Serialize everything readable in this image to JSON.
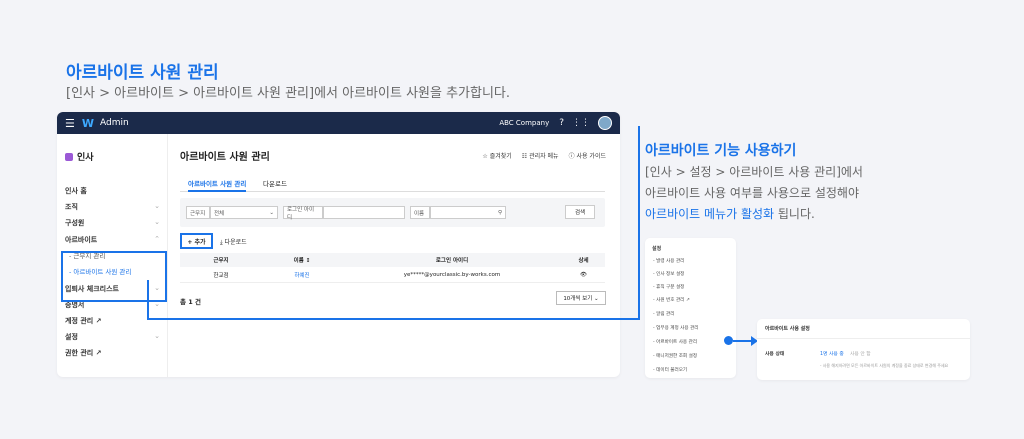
{
  "intro": {
    "title": "아르바이트 사원 관리",
    "path": "[인사 > 아르바이트 > 아르바이트 사원 관리]에서 아르바이트 사원을 추가합니다."
  },
  "usage": {
    "title": "아르바이트 기능 사용하기",
    "line1": "[인사 > 설정 > 아르바이트 사용 관리]에서",
    "line2": "아르바이트 사용 여부를 사용으로 설정해야",
    "line3_hl": "아르바이트 메뉴가 활성화",
    "line3_rest": " 됩니다."
  },
  "topbar": {
    "menu_icon": "☰",
    "logo": "W",
    "app_name": "Admin",
    "company": "ABC Company",
    "help_icon": "?",
    "grid_icon": "⋮⋮"
  },
  "sidebar": {
    "section": "인사",
    "items": [
      {
        "label": "인사 홈",
        "chev": ""
      },
      {
        "label": "조직",
        "chev": "⌄"
      },
      {
        "label": "구성원",
        "chev": "⌄"
      },
      {
        "label": "아르바이트",
        "chev": "⌃"
      },
      {
        "label": "입퇴사 체크리스트",
        "chev": "⌄"
      },
      {
        "label": "증명서",
        "chev": "⌄"
      },
      {
        "label": "계정 관리 ↗",
        "chev": ""
      },
      {
        "label": "설정",
        "chev": "⌄"
      },
      {
        "label": "권한 관리 ↗",
        "chev": ""
      }
    ],
    "subitems": [
      {
        "label": "- 근무지 관리"
      },
      {
        "label": "- 아르바이트 사원 관리"
      }
    ]
  },
  "main": {
    "title": "아르바이트 사원 관리",
    "actions": [
      "☆ 즐겨찾기",
      "☷ 관리자 메뉴",
      "ⓘ 사용 가이드"
    ],
    "tabs": [
      "아르바이트 사원 관리",
      "다운로드"
    ],
    "filter": {
      "workplace_label": "근무지",
      "workplace_value": "전체",
      "login_label": "로그인 아이디",
      "name_label": "이름",
      "search_icon": "⚲",
      "search_button": "검색"
    },
    "add_button": "+ 추가",
    "download_link": "⤓ 다운로드",
    "table": {
      "headers": [
        "근무지",
        "이름 ↕",
        "로그인 아이디",
        "상세"
      ],
      "rows": [
        {
          "workplace": "한교점",
          "name": "하예진",
          "login": "ye*****@yourclassic.by-works.com",
          "detail": "👁"
        }
      ]
    },
    "total": "총 1 건",
    "page_size": "10개씩 보기 ⌄"
  },
  "settings_menu": {
    "title": "설정",
    "items": [
      "- 발령 사용 관리",
      "- 인사 정보 설정",
      "- 휴직 구분 설정",
      "- 사원 번호 관리 ↗",
      "- 알림 관리",
      "- 업무용 계정 사용 관리",
      "- 아르바이트 사용 관리",
      "- 매니저권한 조회 설정",
      "- 데이터 불러오기"
    ]
  },
  "usage_setting": {
    "title": "아르바이트 사용 설정",
    "label": "사용 상태",
    "option_on": "1명 사용 중",
    "option_off": "사용 안 함",
    "note": "- 사용 해지하려면 모든 아르바이트 사원의 계정을 중료 상태로 변경해 주세요"
  }
}
